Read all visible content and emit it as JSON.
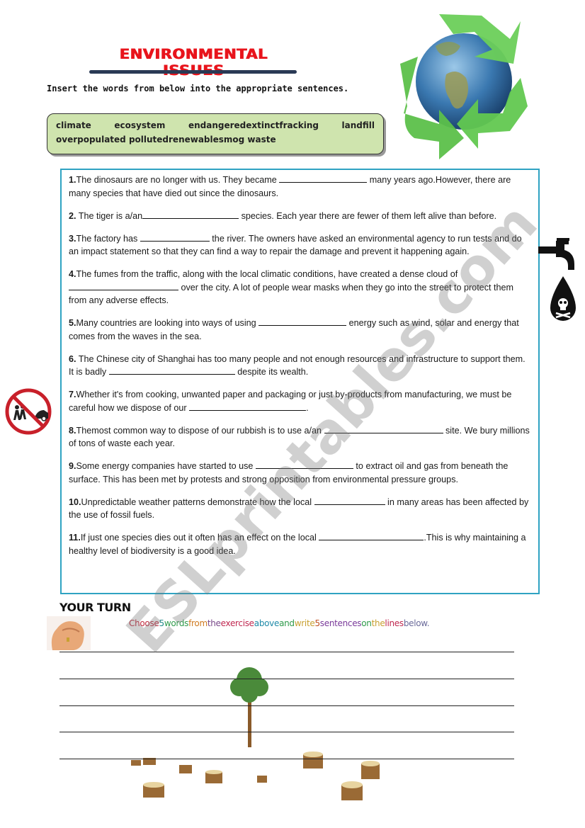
{
  "title": "ENVIRONMENTAL ISSUES",
  "instruction": "Insert the words from below into the appropriate sentences.",
  "word_bank": {
    "row1": [
      "climate",
      "ecosystem",
      "endangeredextinctfracking",
      "landfill"
    ],
    "row2": "overpopulated pollutedrenewablesmog waste"
  },
  "questions": [
    {
      "num": "1.",
      "before": "The dinosaurs are no longer with us. They became ",
      "after": " many years ago.However, there are many species that have died out since the dinosaurs."
    },
    {
      "num": "2.",
      "before": " The tiger is a/an",
      "after": " species. Each year there are fewer of them left alive than before."
    },
    {
      "num": "3.",
      "before": "The factory has ",
      "after": " the river. The owners have asked an environmental agency to run tests and do an impact statement so that they can find a way to repair the damage and prevent it happening again."
    },
    {
      "num": "4.",
      "before": "The fumes from the traffic, along with the local climatic conditions, have created a dense cloud of ",
      "after": " over the city. A lot of people wear masks when they go into the street to protect them from any adverse effects."
    },
    {
      "num": "5.",
      "before": "Many countries are looking into ways of using ",
      "after": " energy such as wind, solar and energy that comes from the waves in the sea."
    },
    {
      "num": "6.",
      "before": " The Chinese city of Shanghai has too many people and not enough resources and infrastructure to support them. It is badly ",
      "after": " despite its wealth."
    },
    {
      "num": "7.",
      "before": "Whether it's from cooking, unwanted paper and packaging or just by-products from manufacturing, we must be careful how we dispose of our ",
      "after": "."
    },
    {
      "num": "8.",
      "before": "Themost common way to dispose of our rubbish is to use a/an ",
      "after": " site. We bury millions of tons of waste each year."
    },
    {
      "num": "9.",
      "before": "Some energy companies have started to use ",
      "after": " to extract oil and gas from beneath the surface. This has been met by protests and strong opposition from environmental pressure groups."
    },
    {
      "num": "10.",
      "before": "Unpredictable weather patterns demonstrate how the local ",
      "after": " in many areas has been affected by the use of fossil fuels."
    },
    {
      "num": "11.",
      "before": "If just one species dies out it often has an effect on the local ",
      "after": ".This is why maintaining a healthy level of biodiversity is a good idea."
    }
  ],
  "your_turn": {
    "heading": "YOUR TURN",
    "instruction_words": [
      {
        "text": "Choose",
        "color": "#c0283c"
      },
      {
        "text": "5",
        "color": "#1f8a8a"
      },
      {
        "text": "words",
        "color": "#2e9a4a"
      },
      {
        "text": "from",
        "color": "#d07a20"
      },
      {
        "text": "the",
        "color": "#7a4a8a"
      },
      {
        "text": "exercise",
        "color": "#c02850"
      },
      {
        "text": "above",
        "color": "#1f8aa8"
      },
      {
        "text": "and",
        "color": "#2e9a4a"
      },
      {
        "text": "write",
        "color": "#c8a030"
      },
      {
        "text": "5",
        "color": "#c05020"
      },
      {
        "text": "sentences",
        "color": "#7a3a9a"
      },
      {
        "text": "on",
        "color": "#2e9a4a"
      },
      {
        "text": "the",
        "color": "#c8a030"
      },
      {
        "text": "lines",
        "color": "#c02850"
      },
      {
        "text": "below.",
        "color": "#6a6a9a"
      }
    ],
    "line_count": 5
  },
  "watermark": "ESLprintables.com",
  "colors": {
    "title": "#e8141c",
    "title_bar": "#2a3a55",
    "word_bank_bg": "#cfe4ae",
    "exercise_border": "#2fa3c2"
  }
}
